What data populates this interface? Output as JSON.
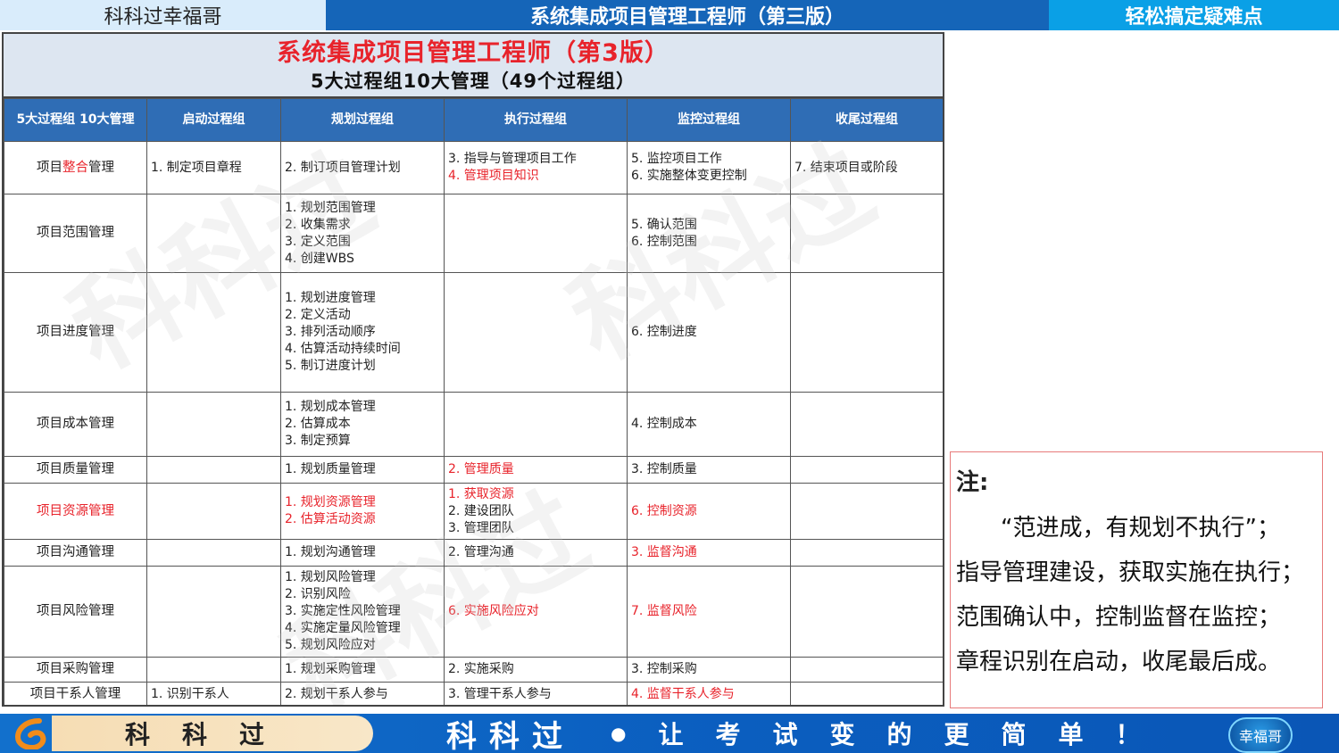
{
  "header": {
    "left": "科科过幸福哥",
    "center": "系统集成项目管理工程师（第三版）",
    "right": "轻松搞定疑难点"
  },
  "sheet": {
    "title": "系统集成项目管理工程师（第3版）",
    "subtitle": "5大过程组10大管理（49个过程组）",
    "watermark": "科科过",
    "columns": {
      "c0a": "5大过程组",
      "c0b": "10大管理",
      "c1": "启动过程组",
      "c2": "规划过程组",
      "c3": "执行过程组",
      "c4": "监控过程组",
      "c5": "收尾过程组"
    },
    "rows": {
      "integration": {
        "name_a": "项目",
        "name_b": "整合",
        "name_c": "管理",
        "init": "1. 制定项目章程",
        "plan": "2. 制订项目管理计划",
        "exec1": "3. 指导与管理项目工作",
        "exec2": "4. 管理项目知识",
        "mon1": "5. 监控项目工作",
        "mon2": "6. 实施整体变更控制",
        "close": "7. 结束项目或阶段"
      },
      "scope": {
        "name": "项目范围管理",
        "plan1": "1. 规划范围管理",
        "plan2": "2. 收集需求",
        "plan3": "3. 定义范围",
        "plan4": "4. 创建WBS",
        "mon1": "5. 确认范围",
        "mon2": "6. 控制范围"
      },
      "schedule": {
        "name": "项目进度管理",
        "plan1": "1. 规划进度管理",
        "plan2": "2. 定义活动",
        "plan3": "3. 排列活动顺序",
        "plan4": "4. 估算活动持续时间",
        "plan5": "5. 制订进度计划",
        "mon": "6. 控制进度"
      },
      "cost": {
        "name": "项目成本管理",
        "plan1": "1. 规划成本管理",
        "plan2": "2. 估算成本",
        "plan3": "3. 制定预算",
        "mon": "4. 控制成本"
      },
      "quality": {
        "name": "项目质量管理",
        "plan": "1. 规划质量管理",
        "exec": "2. 管理质量",
        "mon": "3. 控制质量"
      },
      "resource": {
        "name": "项目资源管理",
        "plan1": "1. 规划资源管理",
        "plan2": "2. 估算活动资源",
        "exec1": "1. 获取资源",
        "exec2": "2. 建设团队",
        "exec3": "3. 管理团队",
        "mon": "6. 控制资源"
      },
      "comm": {
        "name": "项目沟通管理",
        "plan": "1. 规划沟通管理",
        "exec": "2. 管理沟通",
        "mon": "3. 监督沟通"
      },
      "risk": {
        "name": "项目风险管理",
        "plan1": "1. 规划风险管理",
        "plan2": "2. 识别风险",
        "plan3": "3. 实施定性风险管理",
        "plan4": "4. 实施定量风险管理",
        "plan5": "5. 规划风险应对",
        "exec": "6. 实施风险应对",
        "mon": "7. 监督风险"
      },
      "procure": {
        "name": "项目采购管理",
        "plan": "1. 规划采购管理",
        "exec": "2. 实施采购",
        "mon": "3. 控制采购"
      },
      "stakeholder": {
        "name": "项目干系人管理",
        "init": "1. 识别干系人",
        "plan": "2. 规划干系人参与",
        "exec": "3. 管理干系人参与",
        "mon": "4. 监督干系人参与"
      }
    }
  },
  "note": {
    "title": "注:",
    "line1": "“范进成，有规划不执行”；",
    "line2": "指导管理建设，获取实施在执行；",
    "line3": "范围确认中，控制监督在监控；",
    "line4": "章程识别在启动，收尾最后成。"
  },
  "footer": {
    "left_text": "科科过",
    "brand": "科科过",
    "dot": "●",
    "slogan": "让考试变的更简单！",
    "badge": "幸福哥"
  },
  "colors": {
    "accent_red": "#e8232b",
    "header_blue": "#1565b8",
    "table_header": "#2f6db5"
  }
}
